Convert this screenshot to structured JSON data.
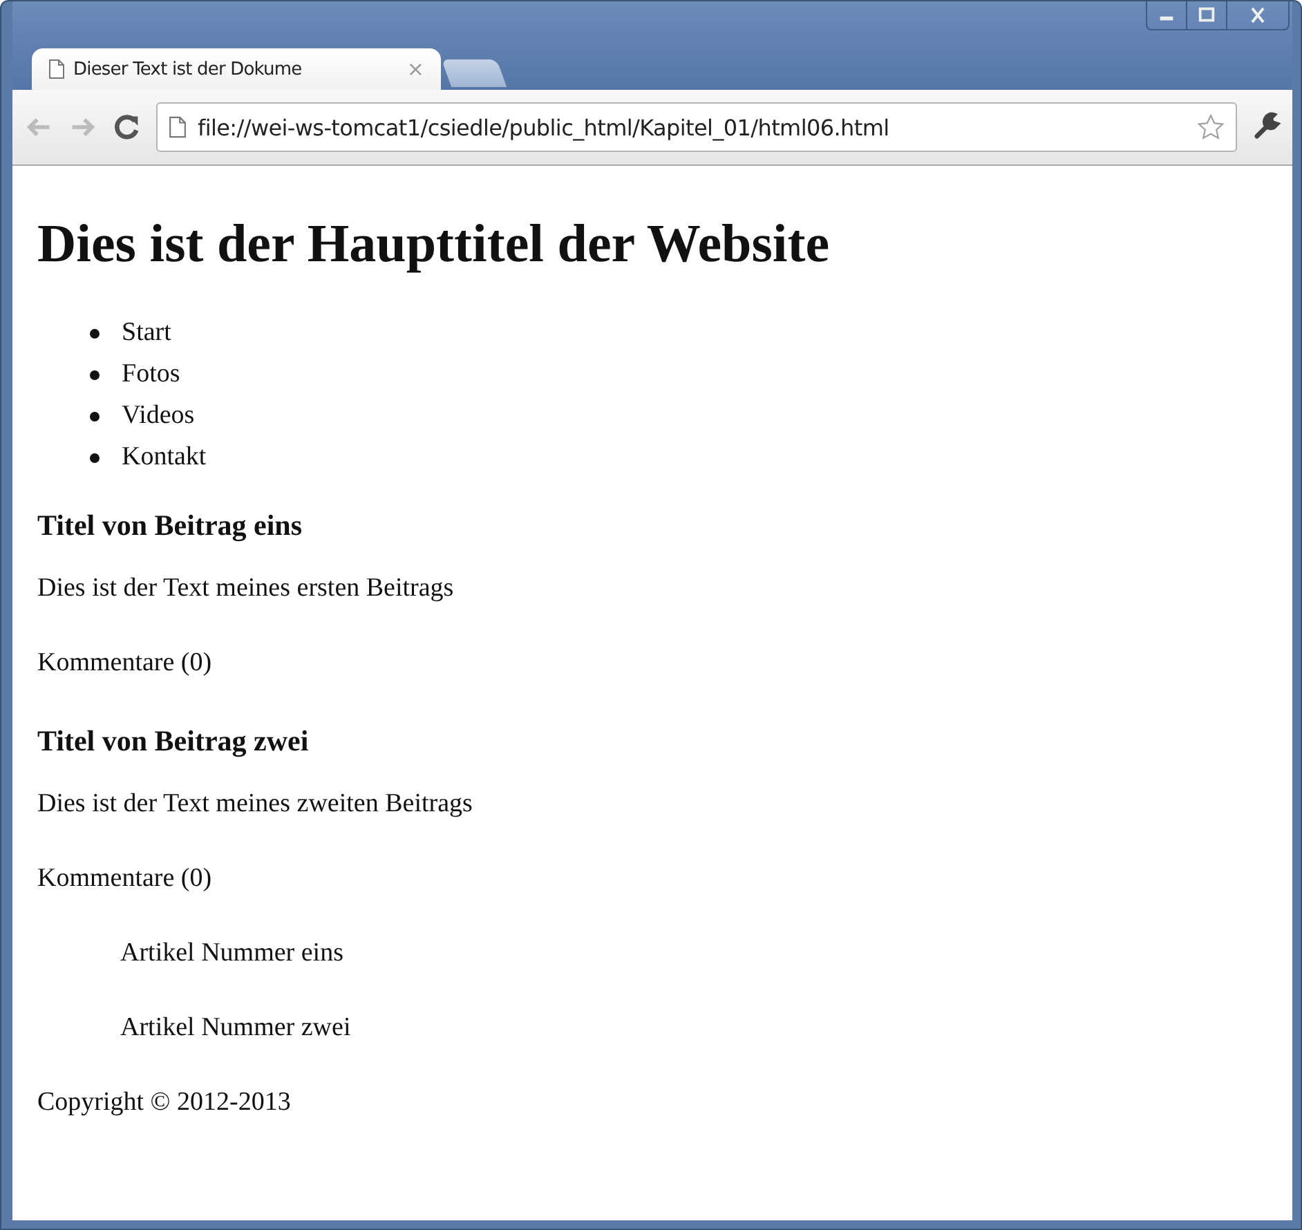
{
  "browser": {
    "tab": {
      "title": "Dieser Text ist der Dokume",
      "close": "×"
    },
    "address": "file://wei-ws-tomcat1/csiedle/public_html/Kapitel_01/html06.html"
  },
  "page": [
    {
      "kind": "h1",
      "text": "Dies ist der Haupttitel der Website"
    },
    {
      "kind": "list",
      "items": [
        "Start",
        "Fotos",
        "Videos",
        "Kontakt"
      ]
    },
    {
      "kind": "h3",
      "text": "Titel von Beitrag eins"
    },
    {
      "kind": "p",
      "text": "Dies ist der Text meines ersten Beitrags"
    },
    {
      "kind": "p",
      "text": "Kommentare (0)"
    },
    {
      "kind": "h3",
      "text": "Titel von Beitrag zwei"
    },
    {
      "kind": "p",
      "text": "Dies ist der Text meines zweiten Beitrags"
    },
    {
      "kind": "p",
      "text": "Kommentare (0)"
    },
    {
      "kind": "indent",
      "text": "Artikel Nummer eins"
    },
    {
      "kind": "indent",
      "text": "Artikel Nummer zwei"
    },
    {
      "kind": "p",
      "text": "Copyright © 2012-2013"
    }
  ]
}
